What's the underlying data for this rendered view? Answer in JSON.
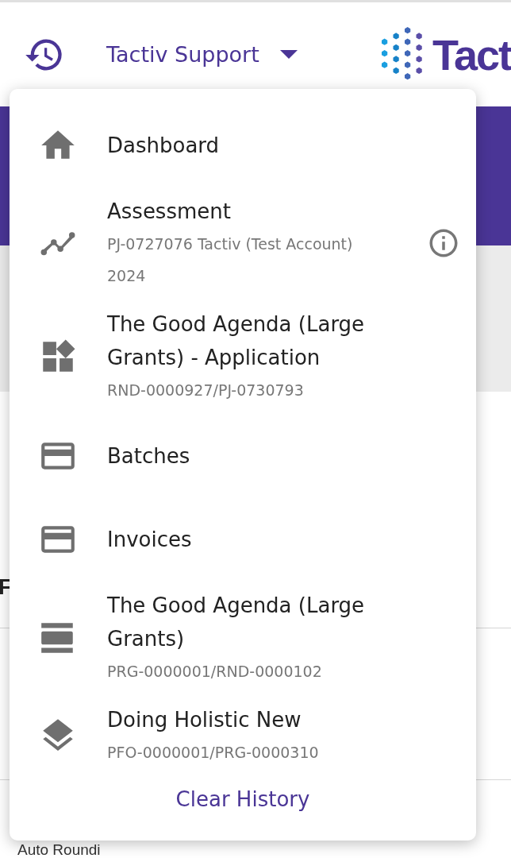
{
  "header": {
    "account": "Tactiv Support",
    "logo_text": "Tact"
  },
  "background": {
    "heading_fragment": "F",
    "label_fragment": "Auto Roundi"
  },
  "history_menu": {
    "items": [
      {
        "kind": "dashboard",
        "title": "Dashboard"
      },
      {
        "kind": "assessment",
        "title": "Assessment",
        "subtitle": "PJ-0727076 Tactiv (Test Account) 2024",
        "info": true
      },
      {
        "kind": "application",
        "title": "The Good Agenda (Large Grants) - Application",
        "subtitle": "RND-0000927/PJ-0730793"
      },
      {
        "kind": "batch",
        "title": "Batches"
      },
      {
        "kind": "invoice",
        "title": "Invoices"
      },
      {
        "kind": "round",
        "title": "The Good Agenda (Large Grants)",
        "subtitle": "PRG-0000001/RND-0000102"
      },
      {
        "kind": "programme",
        "title": "Doing Holistic New",
        "subtitle": "PFO-0000001/PRG-0000310"
      }
    ],
    "clear_label": "Clear History"
  }
}
